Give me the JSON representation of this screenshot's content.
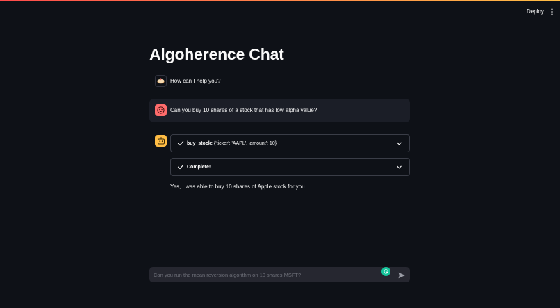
{
  "header": {
    "deploy_label": "Deploy",
    "menu_icon": "kebab-menu-icon"
  },
  "page": {
    "title": "Algoherence Chat"
  },
  "messages": [
    {
      "role": "assistant",
      "avatar_icon": "cake-icon",
      "text": "How can I help you?"
    },
    {
      "role": "user",
      "avatar_icon": "face-icon",
      "avatar_color": "#ff6c6c",
      "text": "Can you buy 10 shares of a stock that has low alpha value?"
    },
    {
      "role": "assistant",
      "avatar_icon": "robot-icon",
      "avatar_color": "#ffbd45",
      "expanders": [
        {
          "status_icon": "check-icon",
          "bold_label": "buy_stock:",
          "detail": "{'ticker': 'AAPL', 'amount': 10}",
          "chevron_icon": "chevron-down-icon"
        },
        {
          "status_icon": "check-icon",
          "bold_label": "Complete!",
          "detail": "",
          "chevron_icon": "chevron-down-icon"
        }
      ],
      "text": "Yes, I was able to buy 10 shares of Apple stock for you."
    }
  ],
  "chat_input": {
    "placeholder": "Can you run the mean reversion algorithm on 10 shares MSFT?",
    "value": "",
    "send_icon": "send-icon",
    "extension_icon": "grammarly-icon"
  },
  "colors": {
    "background": "#0e1117",
    "accent_red": "#ff4b4b",
    "accent_yellow": "#ffbd45",
    "user_avatar": "#ff6c6c",
    "input_bg": "#262730"
  }
}
